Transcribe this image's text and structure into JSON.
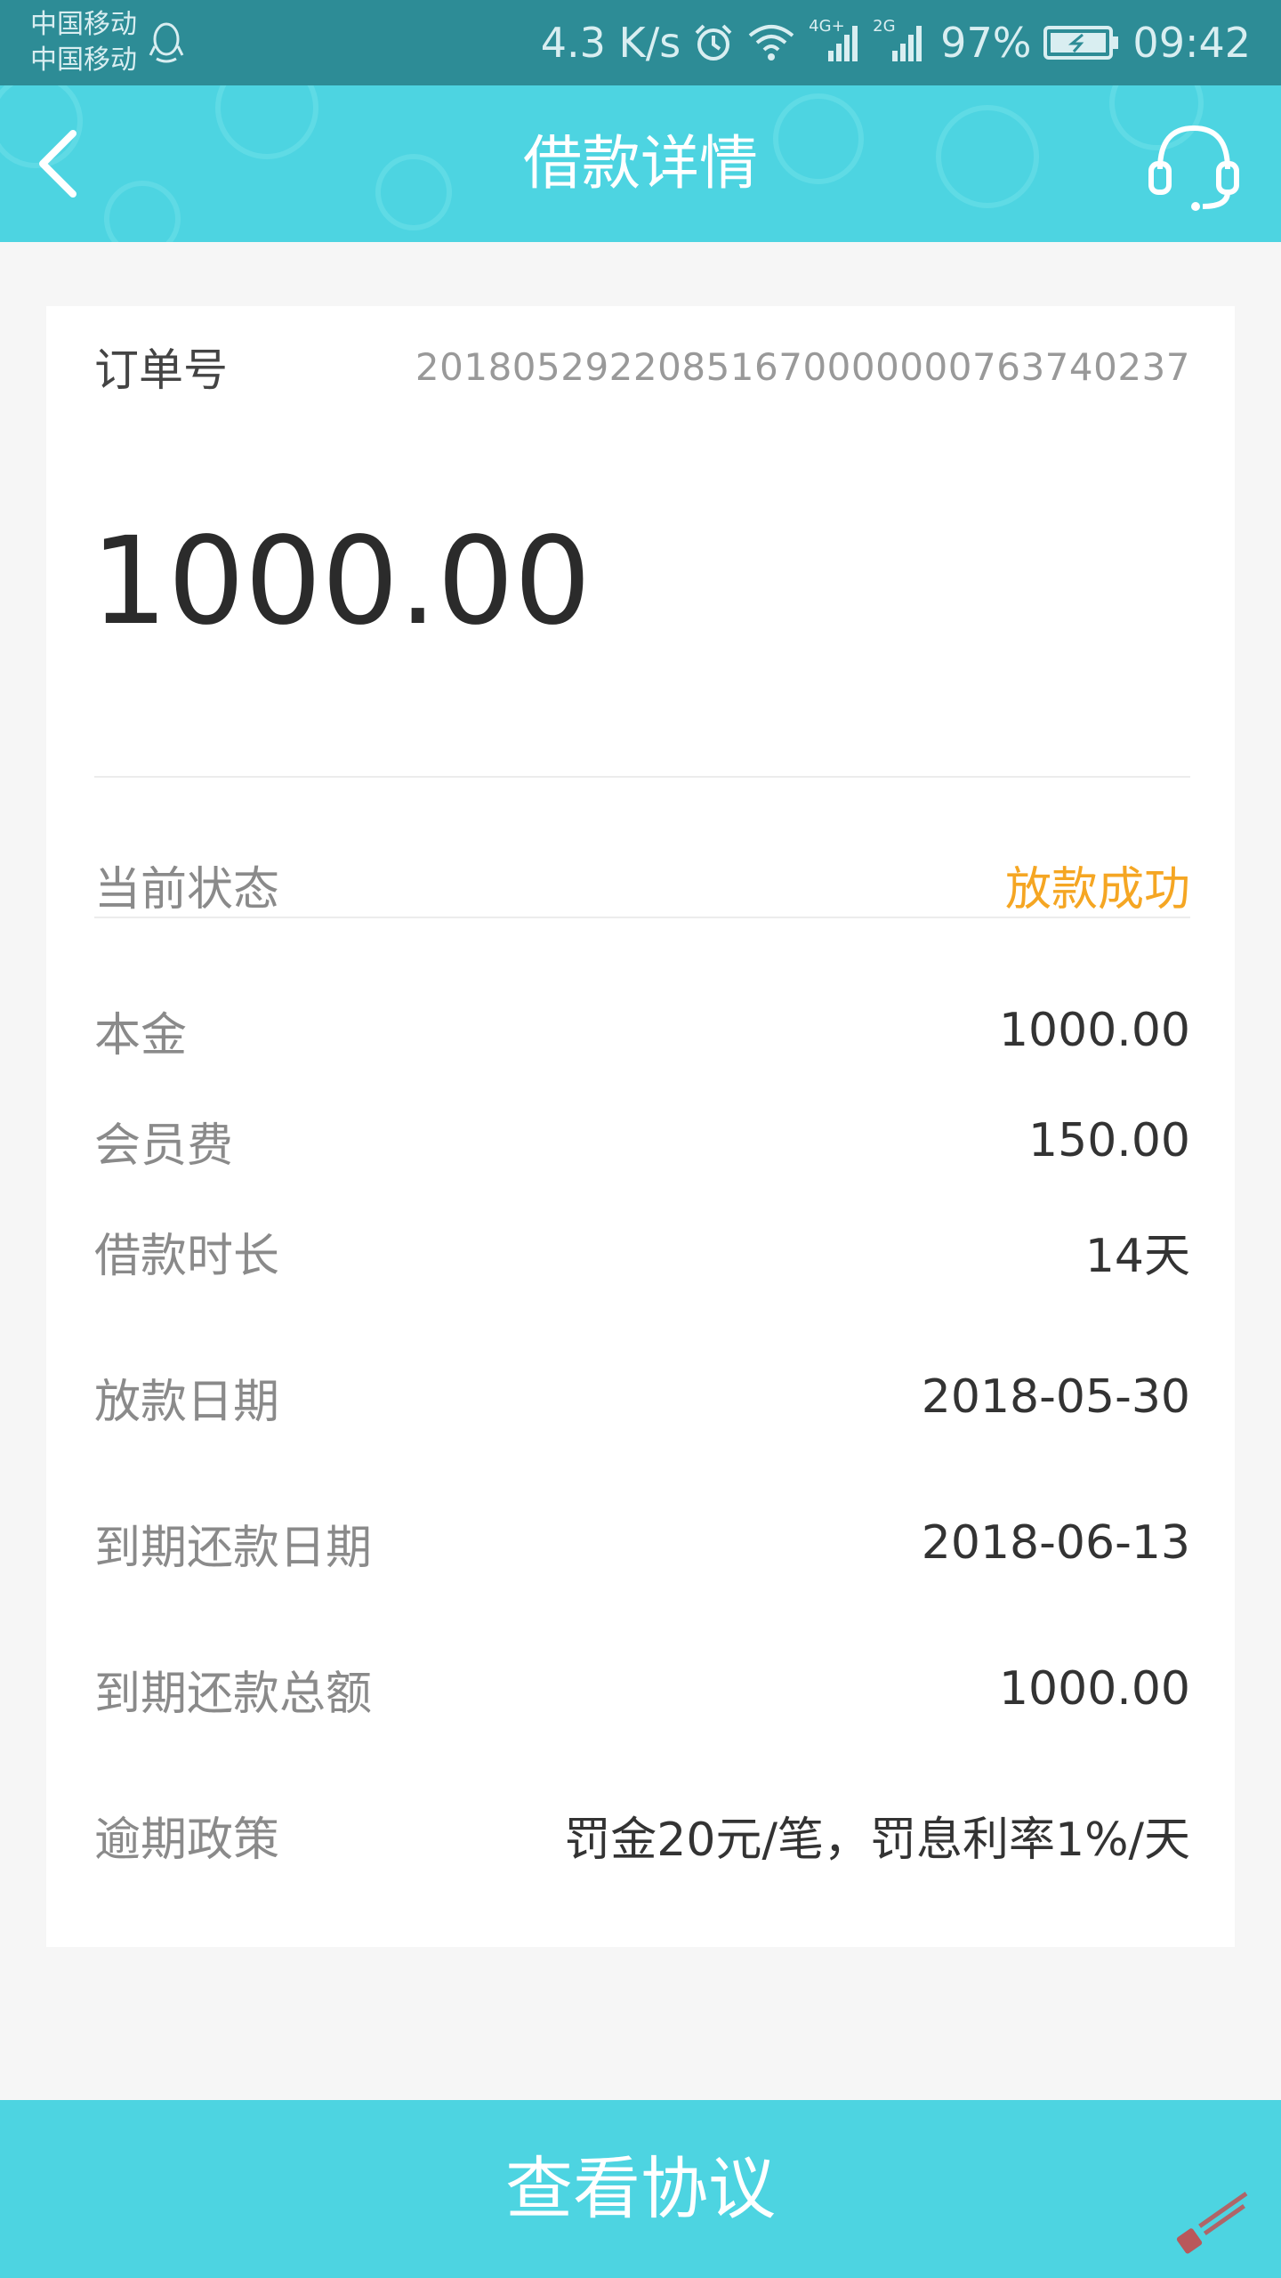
{
  "status_bar": {
    "carrier_1": "中国移动",
    "carrier_2": "中国移动",
    "speed": "4.3 K/s",
    "network_1": "4G+",
    "network_2": "2G",
    "battery": "97%",
    "time": "09:42"
  },
  "header": {
    "title": "借款详情",
    "back_icon": "chevron-left-icon",
    "service_icon": "headset-icon"
  },
  "order": {
    "label": "订单号",
    "value": "20180529220851670000000763740237"
  },
  "amount": "1000.00",
  "status": {
    "label": "当前状态",
    "value": "放款成功"
  },
  "details": [
    {
      "label": "本金",
      "value": "1000.00"
    },
    {
      "label": "会员费",
      "value": "150.00"
    },
    {
      "label": "借款时长",
      "value": "14天"
    },
    {
      "label": "放款日期",
      "value": "2018-05-30"
    },
    {
      "label": "到期还款日期",
      "value": "2018-06-13"
    },
    {
      "label": "到期还款总额",
      "value": "1000.00"
    },
    {
      "label": "逾期政策",
      "value": "罚金20元/笔，罚息利率1%/天"
    }
  ],
  "bottom_button": "查看协议",
  "colors": {
    "accent": "#4dd4e1",
    "status_bar": "#2d8c96",
    "status_value": "#f5a623"
  }
}
